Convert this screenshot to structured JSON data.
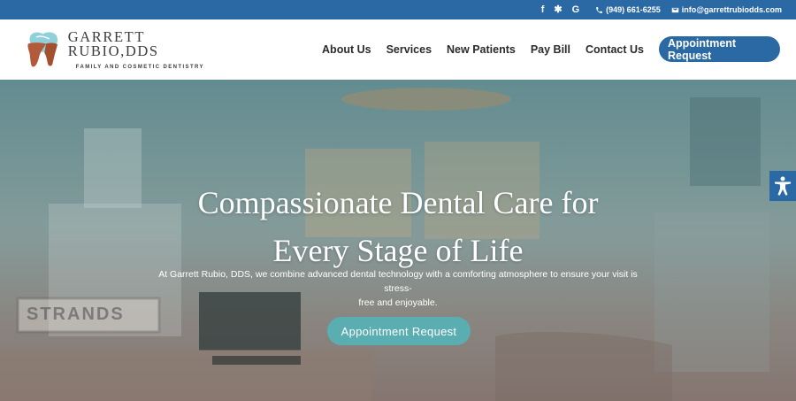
{
  "topbar": {
    "social": [
      {
        "icon": "facebook-icon",
        "glyph": "f"
      },
      {
        "icon": "yelp-icon",
        "glyph": "✱"
      },
      {
        "icon": "google-icon",
        "glyph": "G"
      }
    ],
    "phone": "(949) 661-6255",
    "email": "info@garrettrubiodds.com"
  },
  "logo": {
    "name": "GARRETT RUBIO,DDS",
    "tagline": "FAMILY AND COSMETIC DENTISTRY"
  },
  "nav": {
    "items": [
      "About Us",
      "Services",
      "New Patients",
      "Pay Bill",
      "Contact Us"
    ],
    "cta": "Appointment Request"
  },
  "hero": {
    "title_line1": "Compassionate Dental Care for",
    "title_line2": "Every Stage of Life",
    "subtitle_line1": "At Garrett Rubio, DDS, we combine advanced dental technology with a comforting atmosphere to ensure your visit is stress-",
    "subtitle_line2": "free and enjoyable.",
    "cta": "Appointment Request",
    "sign_text": "STRANDS"
  },
  "colors": {
    "brand_blue": "#2b69a4",
    "teal": "#5aaeb1"
  }
}
